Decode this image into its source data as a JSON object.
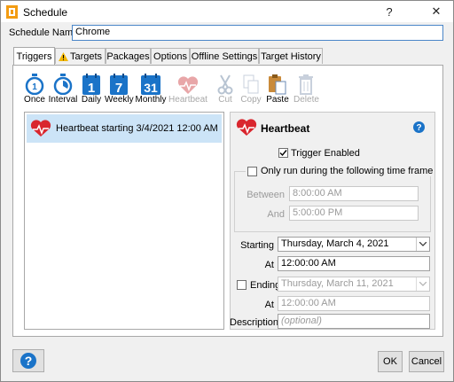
{
  "window": {
    "title": "Schedule"
  },
  "schedule_name": {
    "label": "Schedule Name",
    "value": "Chrome"
  },
  "tabs": [
    "Triggers",
    "Targets",
    "Packages",
    "Options",
    "Offline Settings",
    "Target History"
  ],
  "toolbar": {
    "once": "Once",
    "interval": "Interval",
    "daily": "Daily",
    "weekly": "Weekly",
    "monthly": "Monthly",
    "heartbeat": "Heartbeat",
    "cut": "Cut",
    "copy": "Copy",
    "paste": "Paste",
    "delete": "Delete",
    "daily_num": "1",
    "weekly_num": "7",
    "monthly_num": "31"
  },
  "trigger_list": [
    {
      "label": "Heartbeat starting 3/4/2021 12:00 AM"
    }
  ],
  "detail": {
    "title": "Heartbeat",
    "trigger_enabled": "Trigger Enabled",
    "only_run": "Only run during the following time frame",
    "between_label": "Between",
    "between_value": "8:00:00 AM",
    "and_label": "And",
    "and_value": "5:00:00 PM",
    "starting_label": "Starting",
    "starting_value": "Thursday, March 4, 2021",
    "at_label": "At",
    "at_value": "12:00:00 AM",
    "ending_label": "Ending",
    "ending_value": "Thursday, March 11, 2021",
    "ending_at_label": "At",
    "ending_at_value": "12:00:00 AM",
    "description_label": "Description",
    "description_placeholder": "(optional)"
  },
  "buttons": {
    "ok": "OK",
    "cancel": "Cancel",
    "help": "?"
  },
  "colors": {
    "accent": "#1a73c8",
    "heart": "#d9262e",
    "selection": "#cce4f7"
  }
}
